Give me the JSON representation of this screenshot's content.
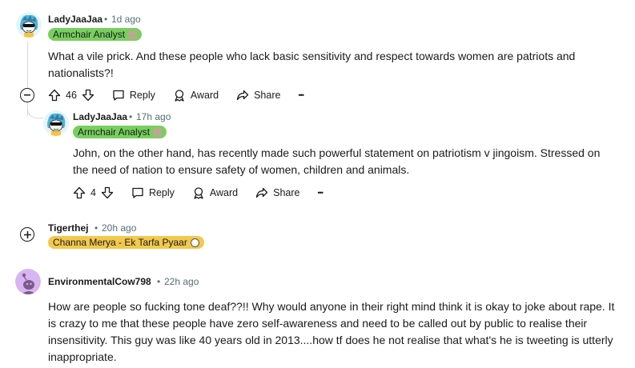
{
  "comments": [
    {
      "username": "LadyJaaJaa",
      "age": "1d ago",
      "flair": "Armchair Analyst",
      "text": "What a vile prick. And these people who lack basic sensitivity and respect towards women are patriots and nationalists?!",
      "score": "46",
      "reply_label": "Reply",
      "award_label": "Award",
      "share_label": "Share",
      "more_label": "•••"
    },
    {
      "username": "LadyJaaJaa",
      "age": "17h ago",
      "flair": "Armchair Analyst",
      "text": "John, on the other hand, has recently made such powerful statement on patriotism v jingoism. Stressed on the need of nation to ensure safety of women, children and animals.",
      "score": "4",
      "reply_label": "Reply",
      "award_label": "Award",
      "share_label": "Share",
      "more_label": "•••"
    },
    {
      "username": "Tigerthej",
      "age": "20h ago",
      "flair": "Channa Merya - Ek Tarfa Pyaar"
    },
    {
      "username": "EnvironmentalCow798",
      "age": "22h ago",
      "text": "How are people so fucking tone deaf??!! Why would anyone in their right mind think it is okay to joke about rape. It is crazy to me that these people have zero self-awareness and need to be called out by public to realise their insensitivity. This guy was like 40 years old in 2013....how tf does he not realise that what's he is tweeting is utterly inappropriate."
    }
  ],
  "separator": "•",
  "colors": {
    "flair_green": "#77d05e",
    "flair_yellow": "#f2c94c",
    "thread_line": "#d6dadc",
    "meta_text": "#576f76",
    "avatar_purple": "#d8b4f0"
  },
  "icons": [
    "upvote-icon",
    "downvote-icon",
    "reply-icon",
    "award-icon",
    "share-icon",
    "collapse-icon",
    "expand-icon"
  ]
}
